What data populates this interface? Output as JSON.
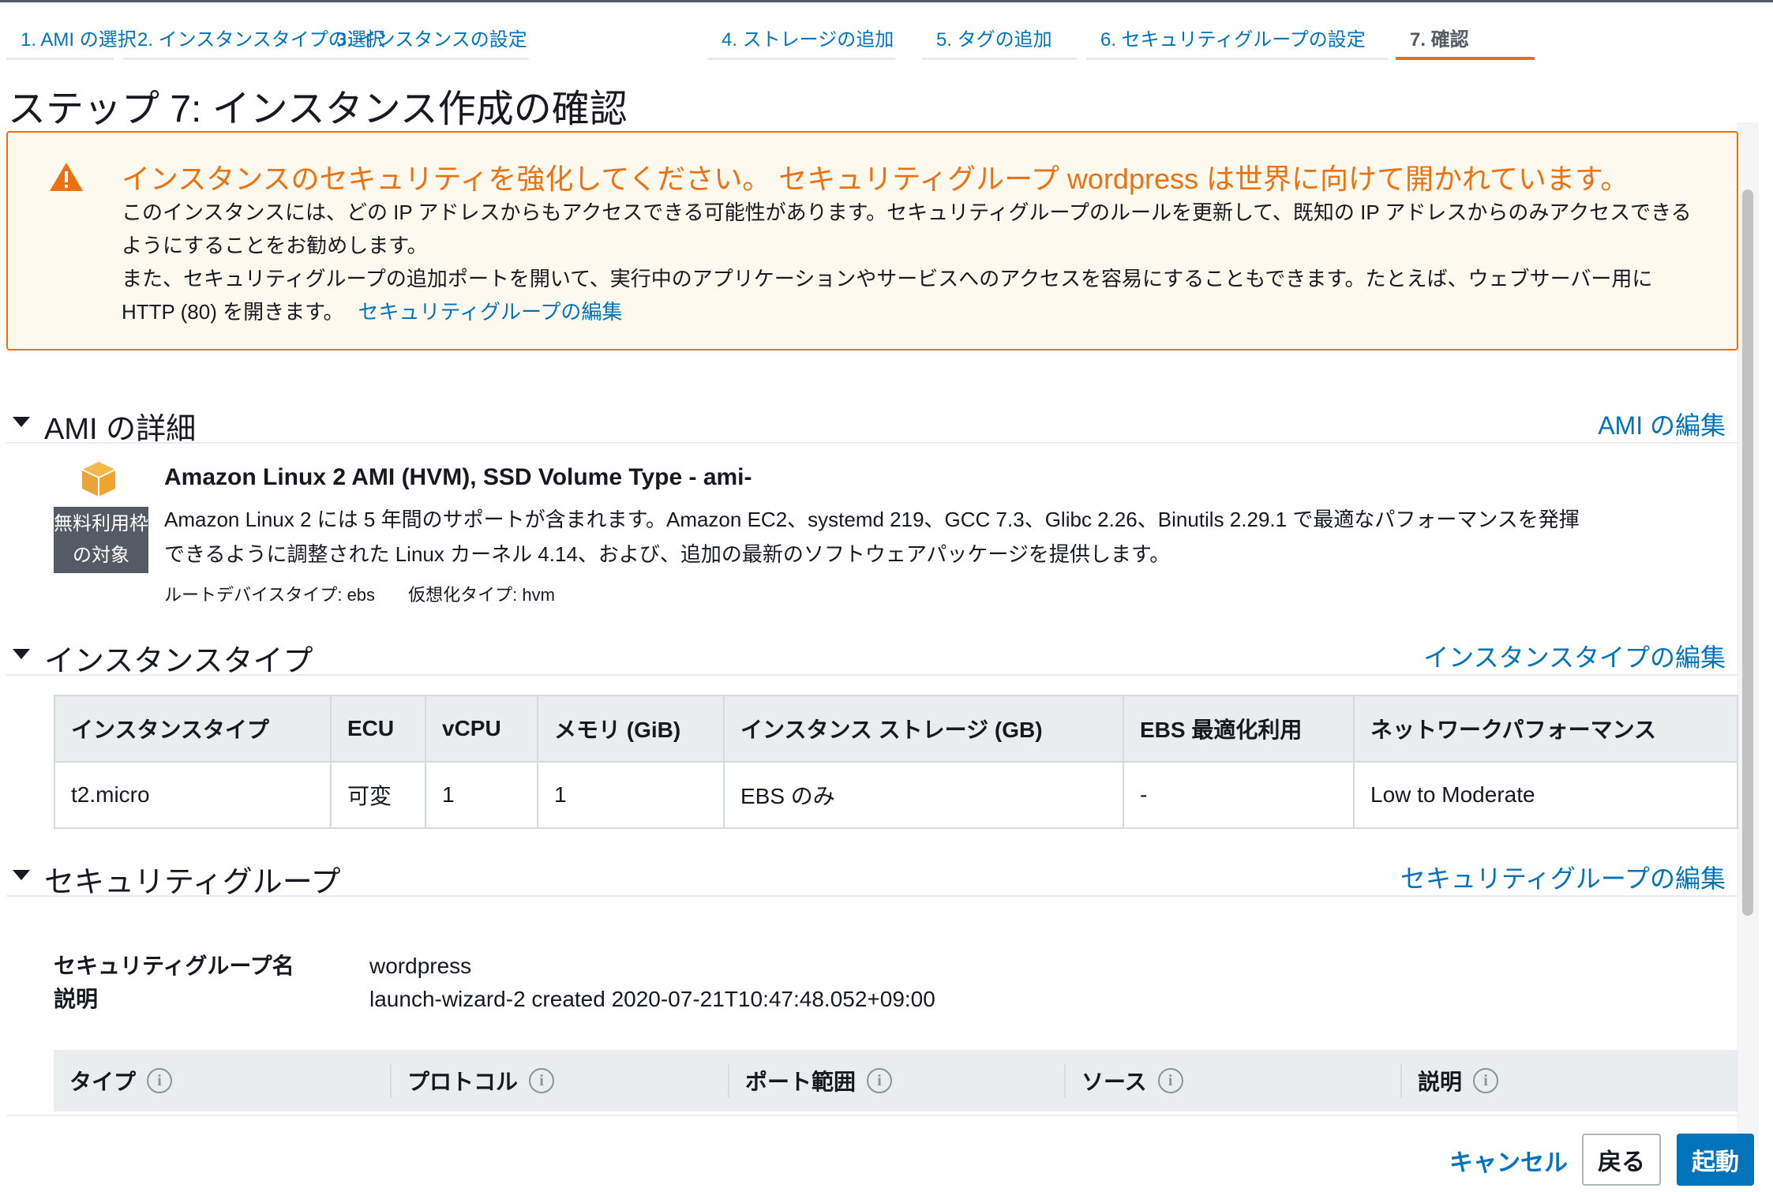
{
  "steps": [
    {
      "label": "1. AMI の選択"
    },
    {
      "label": "2. インスタンスタイプの選択"
    },
    {
      "label": "3. インスタンスの設定"
    },
    {
      "label": "4. ストレージの追加"
    },
    {
      "label": "5. タグの追加"
    },
    {
      "label": "6. セキュリティグループの設定"
    },
    {
      "label": "7. 確認"
    }
  ],
  "page_title": "ステップ 7: インスタンス作成の確認",
  "warning": {
    "title": "インスタンスのセキュリティを強化してください。 セキュリティグループ wordpress は世界に向けて開かれています。",
    "line1": "このインスタンスには、どの IP アドレスからもアクセスできる可能性があります。セキュリティグループのルールを更新して、既知の IP アドレスからのみアクセスできるようにすることをお勧めします。",
    "line2": "また、セキュリティグループの追加ポートを開いて、実行中のアプリケーションやサービスへのアクセスを容易にすることもできます。たとえば、ウェブサーバー用に HTTP (80) を開きます。",
    "link": "セキュリティグループの編集",
    "color": "#ec7211"
  },
  "ami_section": {
    "title": "AMI の詳細",
    "edit": "AMI の編集",
    "name": "Amazon Linux 2 AMI (HVM), SSD Volume Type - ami-",
    "badge_line1": "無料利用枠",
    "badge_line2": "の対象",
    "description": "Amazon Linux 2 には 5 年間のサポートが含まれます。Amazon EC2、systemd 219、GCC 7.3、Glibc 2.26、Binutils 2.29.1 で最適なパフォーマンスを発揮できるように調整された Linux カーネル 4.14、および、追加の最新のソフトウェアパッケージを提供します。",
    "root_device": "ルートデバイスタイプ: ebs",
    "virtualization": "仮想化タイプ: hvm"
  },
  "instance_section": {
    "title": "インスタンスタイプ",
    "edit": "インスタンスタイプの編集",
    "headers": [
      "インスタンスタイプ",
      "ECU",
      "vCPU",
      "メモリ (GiB)",
      "インスタンス ストレージ (GB)",
      "EBS 最適化利用",
      "ネットワークパフォーマンス"
    ],
    "row": [
      "t2.micro",
      "可変",
      "1",
      "1",
      "EBS のみ",
      "-",
      "Low to Moderate"
    ]
  },
  "sg_section": {
    "title": "セキュリティグループ",
    "edit": "セキュリティグループの編集",
    "name_label": "セキュリティグループ名",
    "name_value": "wordpress",
    "desc_label": "説明",
    "desc_value": "launch-wizard-2 created 2020-07-21T10:47:48.052+09:00",
    "rule_headers": [
      "タイプ",
      "プロトコル",
      "ポート範囲",
      "ソース",
      "説明"
    ],
    "info_glyph": "i"
  },
  "footer": {
    "cancel": "キャンセル",
    "back": "戻る",
    "launch": "起動"
  }
}
